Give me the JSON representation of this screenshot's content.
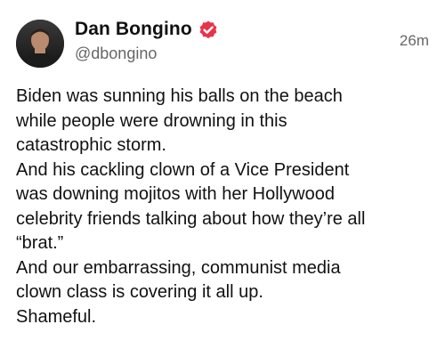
{
  "post": {
    "author": {
      "display_name": "Dan Bongino",
      "handle": "@dbongino",
      "verified": true,
      "verified_color": "#e8334a",
      "avatar_icon": "profile-photo"
    },
    "timestamp": "26m",
    "body_lines": [
      "Biden was sunning his balls on the beach",
      "while people were drowning in this",
      "catastrophic storm.",
      "And his cackling clown of a Vice President",
      "was downing mojitos with her Hollywood",
      "celebrity friends talking about how they’re all",
      "“brat.”",
      "And our embarrassing, communist media",
      "clown class is covering it all up.",
      "Shameful."
    ]
  }
}
